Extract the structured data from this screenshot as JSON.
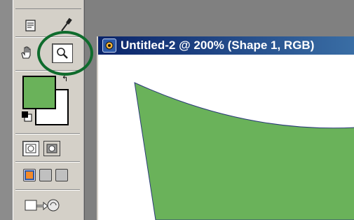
{
  "document": {
    "title": "Untitled-2 @ 200% (Shape 1, RGB)"
  },
  "colors": {
    "foreground": "#6ab25a",
    "background": "#ffffff",
    "shape_fill": "#6ab25a",
    "highlight_ring": "#0e6b2c",
    "workspace": "#808080",
    "titlebar": "#0a246a"
  },
  "tools": {
    "selected": "zoom-tool",
    "visible": [
      "notes-tool",
      "eyedropper-tool",
      "hand-tool",
      "zoom-tool"
    ]
  }
}
